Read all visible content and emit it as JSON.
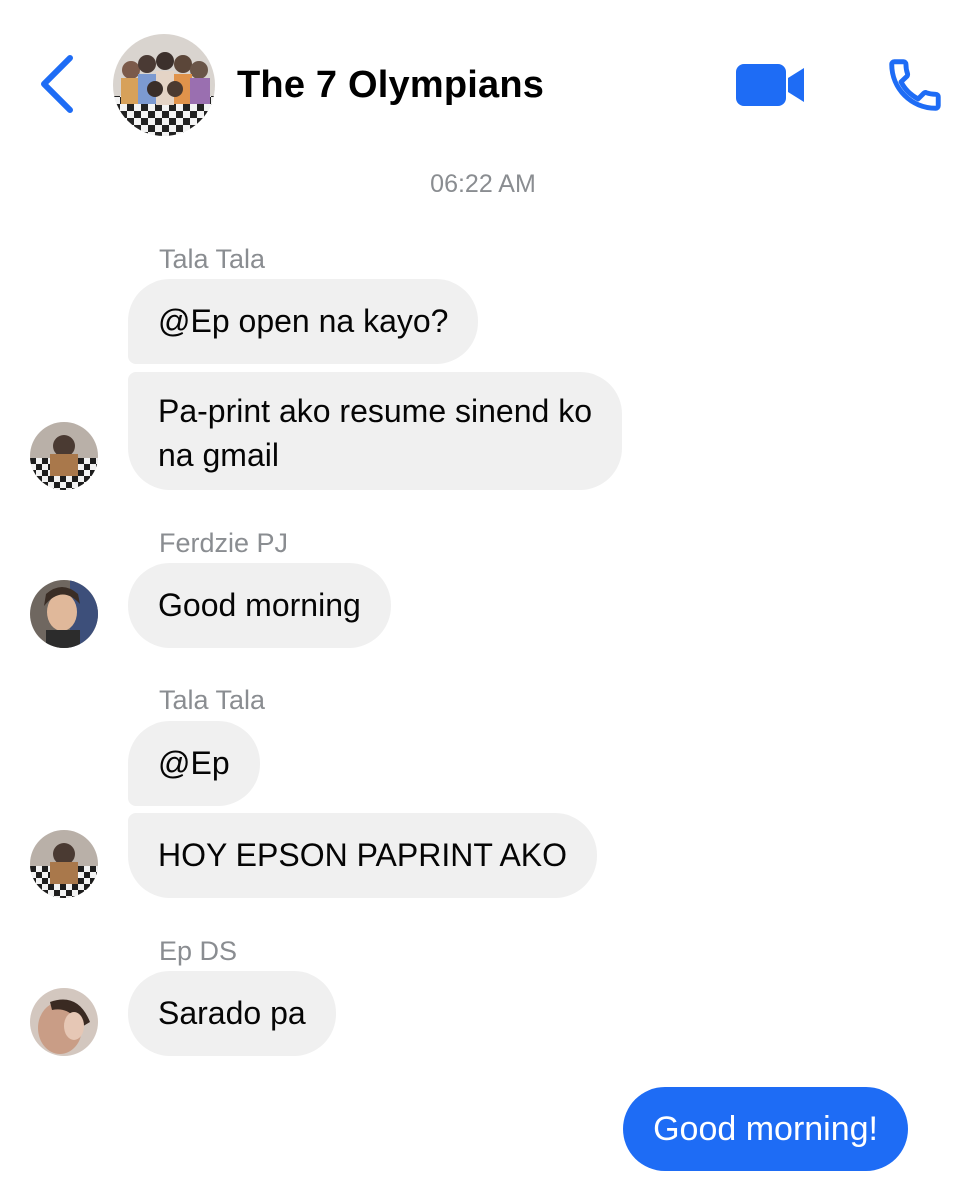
{
  "header": {
    "title": "The 7 Olympians",
    "accent_color": "#1e6cf5",
    "back_icon": "chevron-left-icon",
    "video_icon": "video-camera-icon",
    "call_icon": "phone-icon"
  },
  "thread": {
    "timestamp": "06:22 AM",
    "groups": [
      {
        "sender": "Tala Tala",
        "messages": [
          "@Ep open na kayo?",
          "Pa-print ako resume sinend ko\nna gmail"
        ]
      },
      {
        "sender": "Ferdzie PJ",
        "messages": [
          "Good morning"
        ]
      },
      {
        "sender": "Tala Tala",
        "messages": [
          "@Ep",
          "HOY EPSON PAPRINT AKO"
        ]
      },
      {
        "sender": "Ep DS",
        "messages": [
          "Sarado pa"
        ]
      }
    ],
    "sent": {
      "text": "Good morning!"
    }
  }
}
